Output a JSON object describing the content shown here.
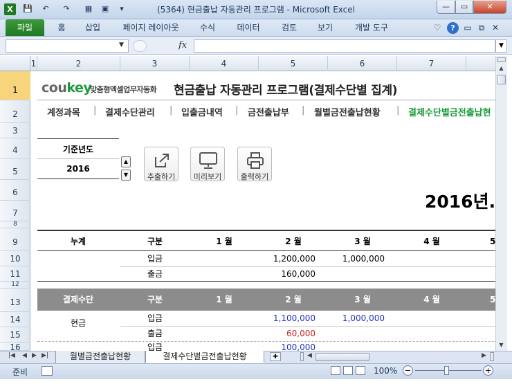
{
  "window": {
    "title": "(5364) 현금출납 자동관리 프로그램 - Microsoft Excel",
    "min_label": "—",
    "max_label": "▭",
    "close_label": "✕"
  },
  "quick_access": {
    "save": "💾",
    "undo": "↶",
    "redo": "↷",
    "icon1": "▦",
    "icon2": "▣",
    "more": "▾"
  },
  "ribbon": {
    "file": "파일",
    "tabs": [
      "홈",
      "삽입",
      "페이지 레이아웃",
      "수식",
      "데이터",
      "검토",
      "보기",
      "개발 도구"
    ],
    "right_icons": [
      "♡",
      "?",
      "▭",
      "⧉",
      "✕"
    ]
  },
  "formula_bar": {
    "name_box": "",
    "fx": "fx",
    "formula": ""
  },
  "columns": [
    "1",
    "2",
    "3",
    "4",
    "5",
    "6",
    "7"
  ],
  "rows": [
    "1",
    "2",
    "3",
    "4",
    "5",
    "6",
    "7",
    "8",
    "9",
    "10",
    "11",
    "12",
    "13",
    "14",
    "15",
    "16"
  ],
  "sheet": {
    "logo": "coukey",
    "logo_co": "cou",
    "logo_key": "key",
    "logo_tagline": "맞춤형엑셀업무자동화",
    "program_title": "현금출납 자동관리 프로그램(결제수단별 집계)",
    "nav": [
      "계정과목",
      "결제수단관리",
      "입출금내역",
      "금전출납부",
      "월별금전출납현황",
      "결제수단별금전출납현"
    ],
    "nav_sep": "|",
    "year_label": "기준년도",
    "year_value": "2016",
    "spin_up": "▲",
    "spin_down": "▼",
    "buttons": [
      {
        "label": "추출하기",
        "icon": "export-icon"
      },
      {
        "label": "미리보기",
        "icon": "monitor-icon"
      },
      {
        "label": "출력하기",
        "icon": "printer-icon"
      }
    ],
    "year_heading": "2016년.",
    "summary_table": {
      "headers": [
        "누계",
        "구분",
        "1 월",
        "2 월",
        "3 월",
        "4 월",
        "5"
      ],
      "rows": [
        {
          "label": "",
          "type": "입금",
          "m1": "",
          "m2": "1,200,000",
          "m3": "1,000,000",
          "m4": ""
        },
        {
          "label": "",
          "type": "출금",
          "m1": "",
          "m2": "160,000",
          "m3": "",
          "m4": ""
        }
      ]
    },
    "detail_table": {
      "headers": [
        "결제수단",
        "구분",
        "1 월",
        "2 월",
        "3 월",
        "4 월",
        "5"
      ],
      "group_label": "현금",
      "rows": [
        {
          "type": "입금",
          "m2": "1,100,000",
          "m3": "1,000,000"
        },
        {
          "type": "출금",
          "m2": "60,000",
          "m3": ""
        },
        {
          "type": "입금",
          "m2": "100,000",
          "m3": ""
        }
      ]
    },
    "colors": {
      "green": "#1a9a3a",
      "blue": "#2233bb",
      "red": "#cc2222",
      "header_gray": "#8c8c8c"
    }
  },
  "sheet_tabs": [
    "월별금전출납현황",
    "결제수단별금전출납현황"
  ],
  "status": {
    "ready": "준비",
    "zoom": "100%",
    "minus": "−",
    "plus": "+"
  }
}
